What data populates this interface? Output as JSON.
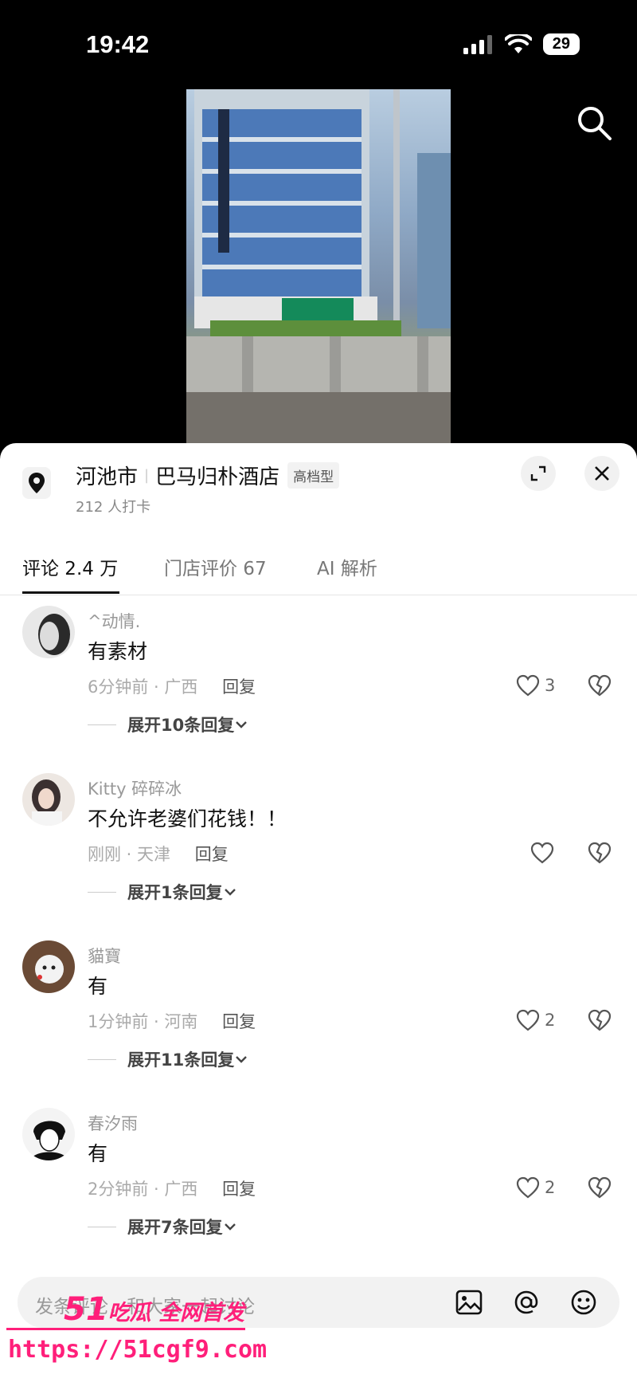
{
  "status_bar": {
    "time": "19:42",
    "battery": "29"
  },
  "location": {
    "city": "河池市",
    "name": "巴马归朴酒店",
    "tier": "高档型",
    "checkins": "212 人打卡"
  },
  "tabs": [
    {
      "label": "评论 2.4 万"
    },
    {
      "label": "门店评价 67"
    },
    {
      "label": "AI 解析"
    }
  ],
  "comments": [
    {
      "user": "^动情.",
      "text": "有素材",
      "time": "6分钟前",
      "region": "广西",
      "reply": "回复",
      "likes": "3",
      "expand": "展开10条回复"
    },
    {
      "user": "Kitty 碎碎冰",
      "text": "不允许老婆们花钱！！",
      "time": "刚刚",
      "region": "天津",
      "reply": "回复",
      "likes": "",
      "expand": "展开1条回复"
    },
    {
      "user": "貓寶",
      "text": "有",
      "time": "1分钟前",
      "region": "河南",
      "reply": "回复",
      "likes": "2",
      "expand": "展开11条回复"
    },
    {
      "user": "春汐雨",
      "text": "有",
      "time": "2分钟前",
      "region": "广西",
      "reply": "回复",
      "likes": "2",
      "expand": "展开7条回复"
    }
  ],
  "composer": {
    "placeholder": "发条评论，和大家一起讨论"
  },
  "watermark": {
    "brand_num": "51",
    "brand_text": "吃瓜 全网首发",
    "url": "https://51cgf9.com"
  },
  "colors": {
    "accent": "#ff1f7a",
    "text": "#111111",
    "muted": "#999999"
  }
}
